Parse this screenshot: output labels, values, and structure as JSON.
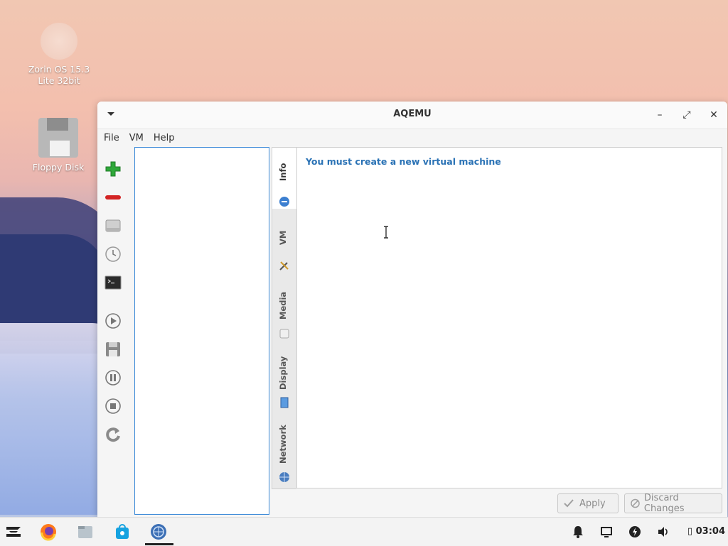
{
  "desktop": {
    "icons": [
      {
        "label": "Zorin OS 15.3 Lite 32bit",
        "icon": "disc-icon"
      },
      {
        "label": "Floppy Disk",
        "icon": "floppy-disk-icon"
      }
    ]
  },
  "window": {
    "title": "AQEMU",
    "controls": {
      "minimize": "–",
      "maximize": "⤢",
      "close": "✕"
    },
    "menu": [
      "File",
      "VM",
      "Help"
    ],
    "toolbar": [
      "add-vm-icon",
      "remove-vm-icon",
      "hard-drive-icon",
      "clock-icon",
      "terminal-icon",
      "play-icon",
      "save-icon",
      "pause-icon",
      "stop-icon",
      "reload-icon"
    ],
    "tabs": [
      {
        "label": "Info",
        "icon": "info-icon"
      },
      {
        "label": "VM",
        "icon": "tools-icon"
      },
      {
        "label": "Media",
        "icon": "media-icon"
      },
      {
        "label": "Display",
        "icon": "display-icon"
      },
      {
        "label": "Network",
        "icon": "network-icon"
      }
    ],
    "active_tab": "Info",
    "info_message": "You must create a new virtual machine",
    "buttons": {
      "apply": "Apply",
      "discard": "Discard Changes"
    }
  },
  "taskbar": {
    "apps": [
      "zorin-menu-icon",
      "firefox-icon",
      "files-icon",
      "software-store-icon",
      "aqemu-icon"
    ],
    "tray": [
      "bell-icon",
      "screen-icon",
      "power-icon",
      "volume-icon"
    ],
    "time": "03:04"
  },
  "colors": {
    "accent": "#3c8ad8",
    "info_text": "#2a72b5"
  }
}
